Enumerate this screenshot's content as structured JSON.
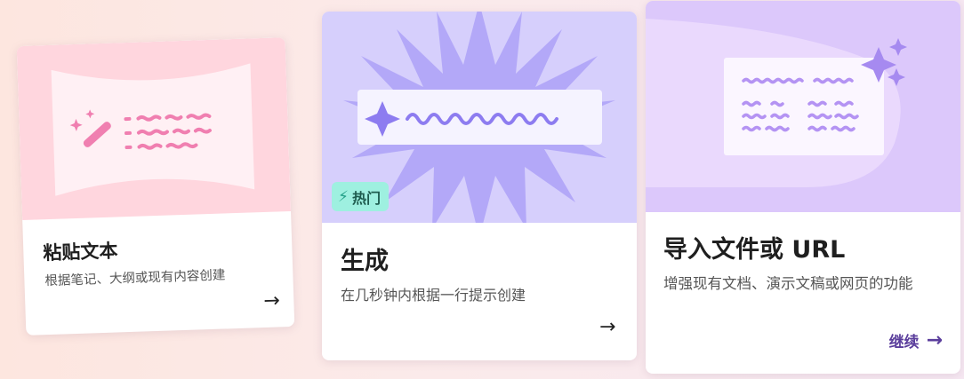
{
  "cards": [
    {
      "title": "粘贴文本",
      "description": "根据笔记、大纲或现有内容创建",
      "icon": "arrow-right-icon",
      "accent": "#ffd6de"
    },
    {
      "title": "生成",
      "description": "在几秒钟内根据一行提示创建",
      "badge": "热门",
      "badge_icon": "lightning-icon",
      "icon": "arrow-right-icon",
      "accent": "#d6cffc"
    },
    {
      "title": "导入文件或 URL",
      "description": "增强现有文档、演示文稿或网页的功能",
      "continue_label": "继续",
      "icon": "arrow-right-icon",
      "accent": "#dcc8fb"
    }
  ]
}
